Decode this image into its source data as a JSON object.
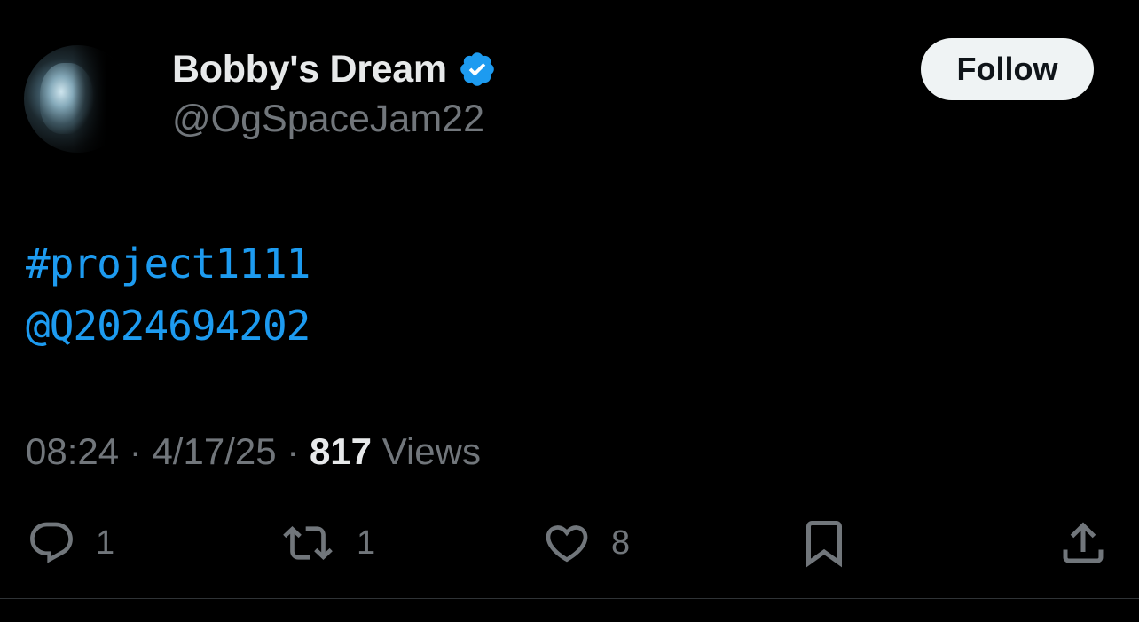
{
  "user": {
    "display_name": "Bobby's Dream",
    "handle": "@OgSpaceJam22",
    "verified": true,
    "verified_icon": "verified-badge-icon"
  },
  "follow_button": {
    "label": "Follow"
  },
  "tweet": {
    "lines": [
      "#project1111",
      "@Q2024694202"
    ]
  },
  "meta": {
    "time": "08:24",
    "separator": "·",
    "date": "4/17/25",
    "views_count": "817",
    "views_label": "Views"
  },
  "actions": {
    "reply": {
      "icon": "reply-icon",
      "count": "1"
    },
    "retweet": {
      "icon": "retweet-icon",
      "count": "1"
    },
    "like": {
      "icon": "heart-icon",
      "count": "8"
    },
    "bookmark": {
      "icon": "bookmark-icon"
    },
    "share": {
      "icon": "share-icon"
    }
  },
  "colors": {
    "background": "#000000",
    "primary_text": "#e7e9ea",
    "secondary_text": "#71767b",
    "accent": "#1d9bf0",
    "follow_bg": "#eff3f4"
  }
}
